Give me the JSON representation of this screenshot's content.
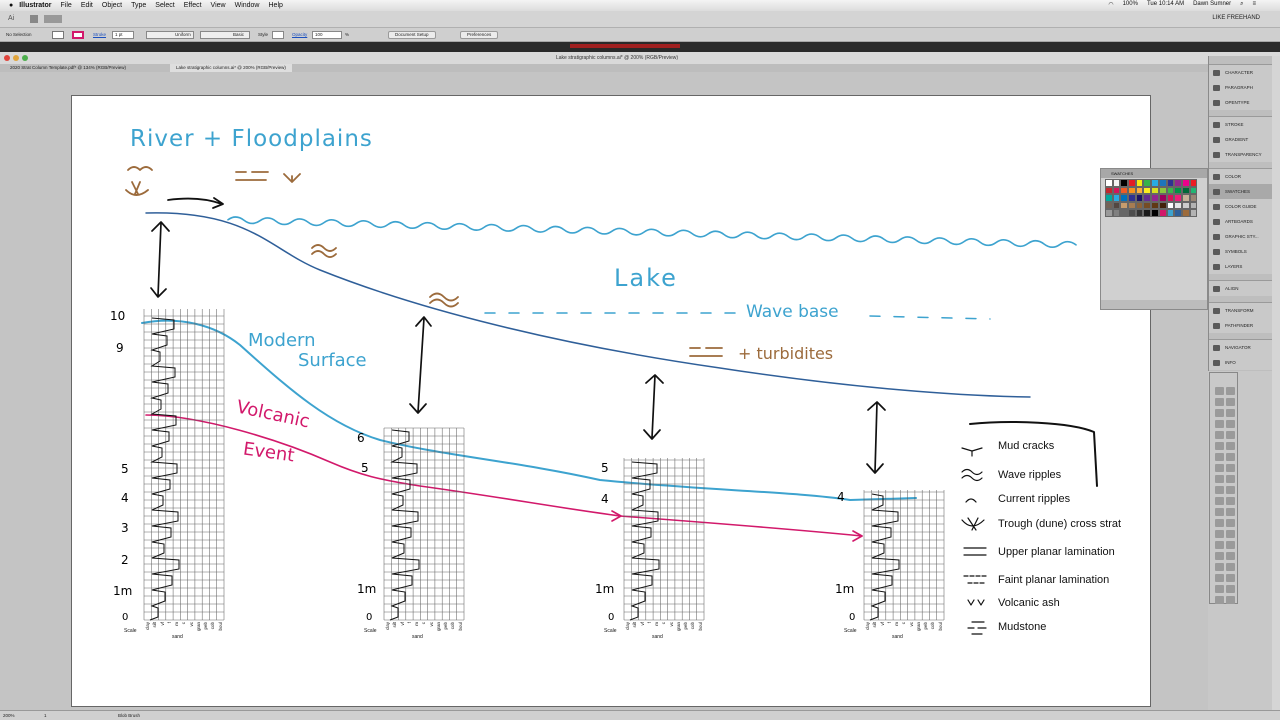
{
  "menubar": {
    "app": "Illustrator",
    "menus": [
      "File",
      "Edit",
      "Object",
      "Type",
      "Select",
      "Effect",
      "View",
      "Window",
      "Help"
    ],
    "battery": "100%",
    "clock": "Tue 10:14 AM",
    "user": "Dawn Sumner"
  },
  "workspace": {
    "name": "LIKE FREEHAND"
  },
  "control": {
    "selection": "No Selection",
    "stroke_label": "Stroke",
    "stroke_value": "1 pt",
    "profile": "Uniform",
    "brush": "Basic",
    "style_label": "Style",
    "opacity_label": "Opacity",
    "opacity_value": "100",
    "opacity_unit": "%",
    "document_setup": "Document Setup",
    "preferences": "Preferences"
  },
  "window": {
    "title": "Lake stratigraphic columns.ai* @ 200% (RGB/Preview)"
  },
  "tabs": [
    {
      "label": "2020 Strat Column Template.pdf* @ 134% (RGB/Preview)",
      "active": false
    },
    {
      "label": "Lake stratigraphic columns.ai* @ 200% (RGB/Preview)",
      "active": true
    }
  ],
  "panels": {
    "group1": [
      "CHARACTER",
      "PARAGRAPH",
      "OPENTYPE"
    ],
    "group2": [
      "STROKE",
      "GRADIENT",
      "TRANSPARENCY"
    ],
    "group3": [
      "COLOR",
      "SWATCHES",
      "COLOR GUIDE",
      "ARTBOARDS",
      "GRAPHIC STY...",
      "SYMBOLS",
      "LAYERS"
    ],
    "group4": [
      "ALIGN"
    ],
    "group5": [
      "TRANSFORM",
      "PATHFINDER"
    ],
    "group6": [
      "NAVIGATOR",
      "INFO"
    ]
  },
  "swatches_panel": {
    "title": "SWATCHES"
  },
  "status": {
    "zoom": "200%",
    "page": "1",
    "tool": "Blob Brush"
  },
  "sketch": {
    "title": "River + Floodplains",
    "lake": "Lake",
    "wave_base": "Wave base",
    "turbidites": "+ turbidites",
    "modern_surface_1": "Modern",
    "modern_surface_2": "Surface",
    "volcanic_1": "Volcanic",
    "volcanic_2": "Event",
    "col1_ticks": [
      "10",
      "9",
      "5",
      "4",
      "3",
      "2",
      "1m",
      "0"
    ],
    "col2_ticks": [
      "6",
      "5",
      "1m",
      "0"
    ],
    "col3_ticks": [
      "5",
      "4",
      "1m",
      "0"
    ],
    "col4_ticks": [
      "4",
      "1m",
      "0"
    ],
    "scale_label": "Scale",
    "grain_labels": [
      "clay",
      "silt",
      "vf",
      "f",
      "m",
      "c",
      "vc",
      "gran",
      "peb",
      "cob",
      "boul"
    ],
    "sand_label": "sand"
  },
  "legend": [
    "Mud cracks",
    "Wave ripples",
    "Current ripples",
    "Trough (dune) cross strat",
    "Upper planar lamination",
    "Faint planar lamination",
    "Volcanic ash",
    "Mudstone"
  ],
  "colors": {
    "blue_light": "#3da3cf",
    "blue_dark": "#2f5f99",
    "brown": "#9c6b3c",
    "magenta": "#d2196b",
    "black": "#111111"
  }
}
